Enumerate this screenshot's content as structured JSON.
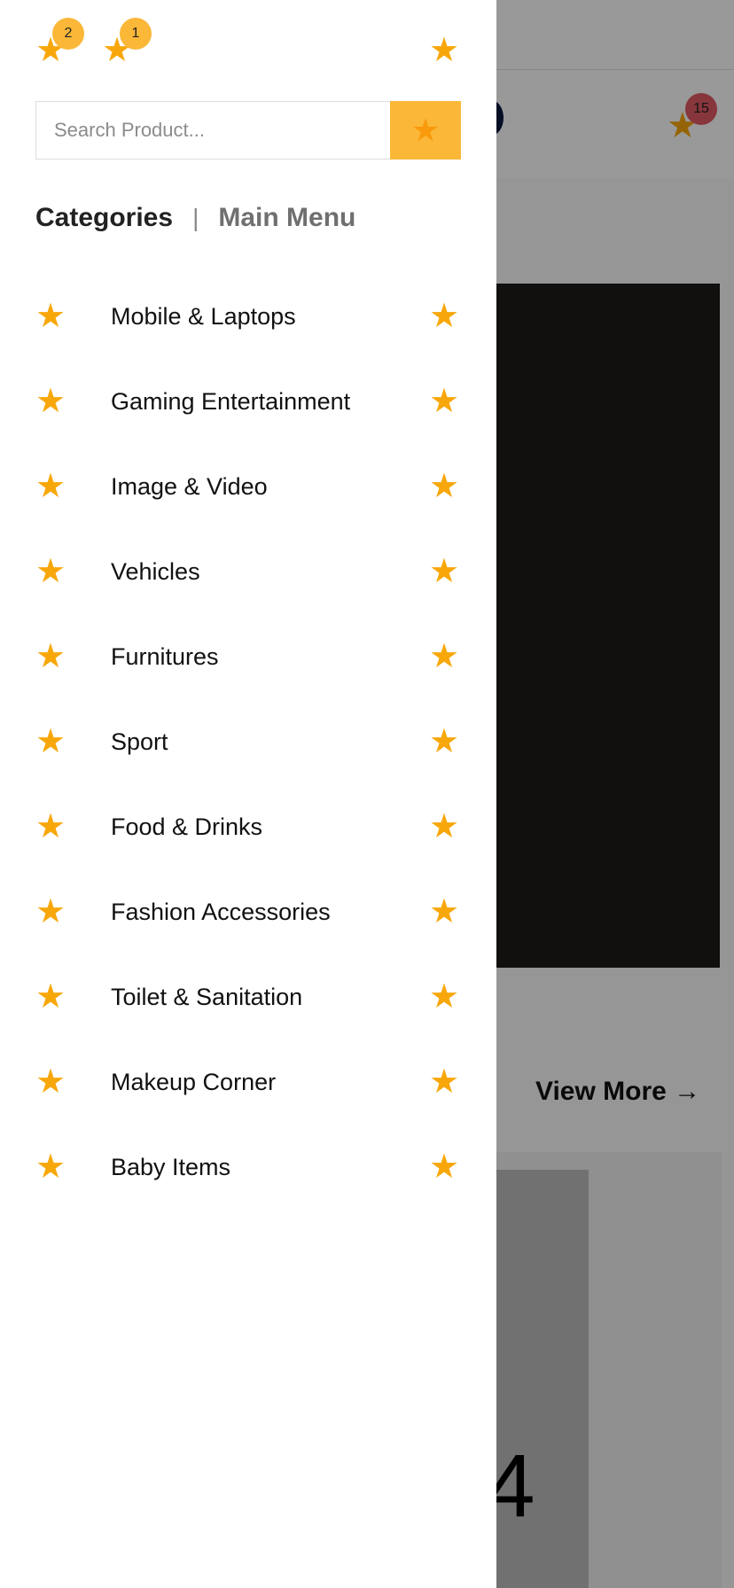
{
  "colors": {
    "accent": "#fbb738",
    "star": "#f8a70b",
    "overlay": "rgba(0,0,0,0.4)"
  },
  "drawer": {
    "top_icons": [
      {
        "icon": "star-icon",
        "badge": "2"
      },
      {
        "icon": "star-icon",
        "badge": "1"
      },
      {
        "icon": "star-icon",
        "badge": null
      }
    ],
    "search": {
      "placeholder": "Search Product...",
      "value": "",
      "button_icon": "star-icon"
    },
    "tabs": {
      "categories": "Categories",
      "separator": "|",
      "main_menu": "Main Menu"
    },
    "categories": [
      {
        "label": "Mobile & Laptops"
      },
      {
        "label": "Gaming Entertainment"
      },
      {
        "label": "Image & Video"
      },
      {
        "label": "Vehicles"
      },
      {
        "label": "Furnitures"
      },
      {
        "label": "Sport"
      },
      {
        "label": "Food & Drinks"
      },
      {
        "label": "Fashion Accessories"
      },
      {
        "label": "Toilet & Sanitation"
      },
      {
        "label": "Makeup Corner"
      },
      {
        "label": "Baby Items"
      }
    ]
  },
  "background": {
    "cart_badge": "15",
    "view_more": "View More →",
    "card_number": "4"
  }
}
